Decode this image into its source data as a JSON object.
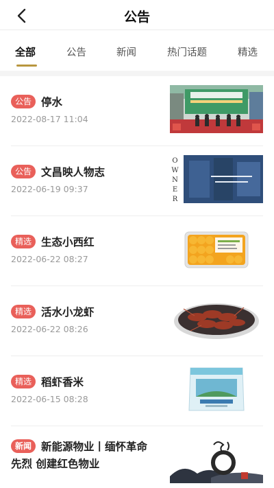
{
  "header": {
    "title": "公告"
  },
  "tabs": [
    "全部",
    "公告",
    "新闻",
    "热门话题",
    "精选"
  ],
  "items": [
    {
      "tag": "公告",
      "title": "停水",
      "date": "2022-08-17 11:04",
      "thumb_icon": "storefront-photo"
    },
    {
      "tag": "公告",
      "title": "文昌映人物志",
      "date": "2022-06-19 09:37",
      "thumb_icon": "owner-magazine-photo",
      "thumb_text": "OWNER"
    },
    {
      "tag": "精选",
      "title": "生态小西红",
      "date": "2022-06-22 08:27",
      "thumb_icon": "cherry-tomato-box-photo"
    },
    {
      "tag": "精选",
      "title": "活水小龙虾",
      "date": "2022-06-22 08:26",
      "thumb_icon": "crayfish-plate-photo"
    },
    {
      "tag": "精选",
      "title": "稻虾香米",
      "date": "2022-06-15 08:28",
      "thumb_icon": "rice-bag-photo"
    },
    {
      "tag": "新闻",
      "title": "新能源物业丨缅怀革命先烈 创建红色物业",
      "thumb_icon": "ink-painting-photo"
    }
  ],
  "colors": {
    "accent": "#b8963e",
    "tag_bg": "#e9605a"
  }
}
